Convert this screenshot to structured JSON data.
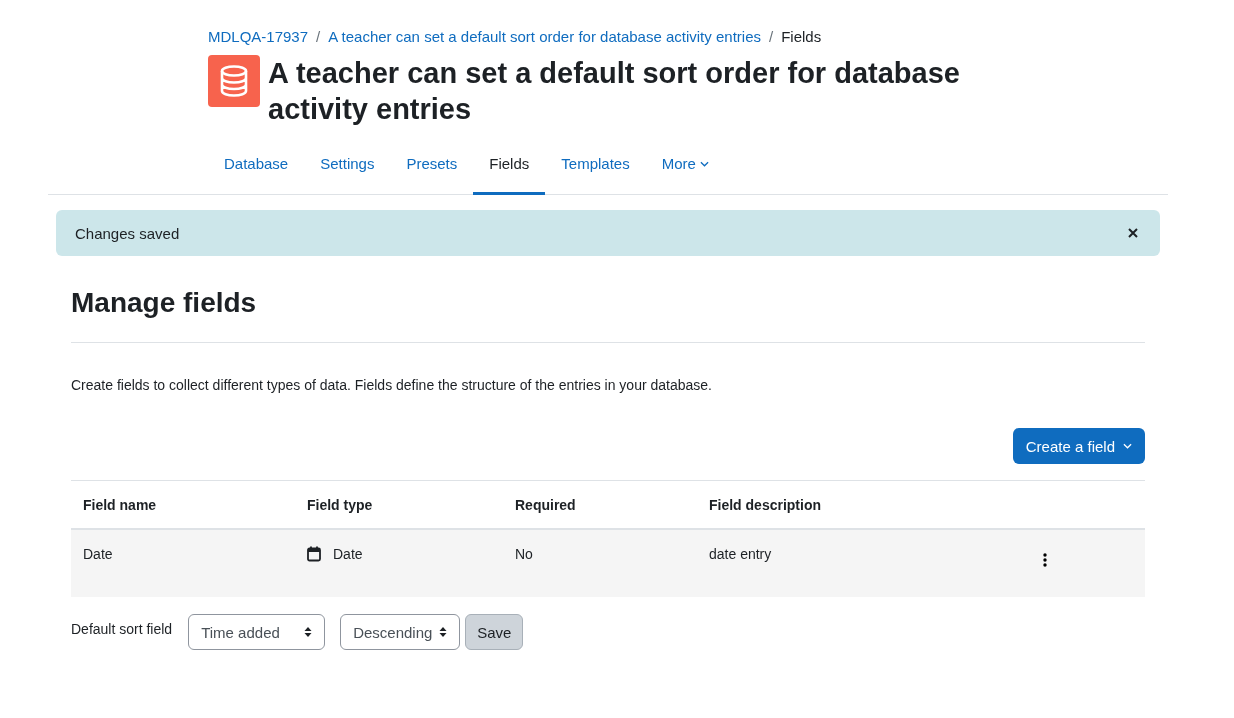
{
  "breadcrumb": [
    {
      "label": "MDLQA-17937",
      "link": true
    },
    {
      "separator": "/",
      "label": "A teacher can set a default sort order for database activity entries",
      "link": true
    },
    {
      "separator": "/",
      "label": "Fields",
      "link": false
    }
  ],
  "title": "A teacher can set a default sort order for database activity entries",
  "tabs": [
    {
      "label": "Database",
      "selected": false,
      "kind": "tab"
    },
    {
      "label": "Settings",
      "selected": false,
      "kind": "tab"
    },
    {
      "label": "Presets",
      "selected": false,
      "kind": "tab"
    },
    {
      "label": "Fields",
      "selected": true,
      "kind": "tab"
    },
    {
      "label": "Templates",
      "selected": false,
      "kind": "tab"
    },
    {
      "label": "More",
      "selected": false,
      "kind": "menu"
    }
  ],
  "alert": {
    "message": "Changes saved"
  },
  "heading": "Manage fields",
  "description": "Create fields to collect different types of data. Fields define the structure of the entries in your database.",
  "create_button": "Create a field",
  "table": {
    "columns": [
      "Field name",
      "Field type",
      "Required",
      "Field description"
    ],
    "rows": [
      {
        "name": "Date",
        "type": "Date",
        "required": "No",
        "description": "date entry"
      }
    ]
  },
  "sort": {
    "label": "Default sort field",
    "field": "Time added",
    "order": "Descending",
    "save": "Save"
  }
}
